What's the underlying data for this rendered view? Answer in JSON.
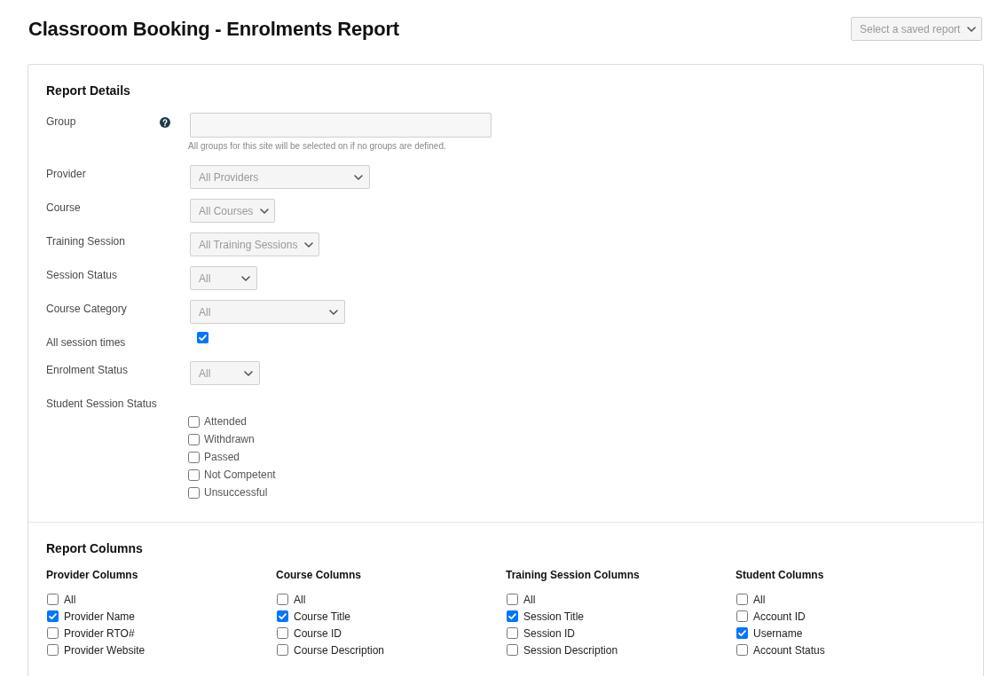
{
  "page": {
    "title": "Classroom Booking - Enrolments Report",
    "saved_report": {
      "value": "Select a saved report"
    }
  },
  "report_details": {
    "heading": "Report Details",
    "fields": [
      {
        "kind": "text",
        "label": "Group",
        "help": true,
        "hint": "All groups for this site will be selected on if no groups are defined."
      },
      {
        "kind": "select",
        "label": "Provider",
        "help": false,
        "value": "All Providers"
      },
      {
        "kind": "select",
        "label": "Course",
        "help": false,
        "value": "All Courses"
      },
      {
        "kind": "select",
        "label": "Training Session",
        "help": false,
        "value": "All Training Sessions"
      },
      {
        "kind": "select",
        "label": "Session Status",
        "help": false,
        "value": "All"
      },
      {
        "kind": "select",
        "label": "Course Category",
        "help": false,
        "value": "All"
      },
      {
        "kind": "checkbox",
        "label": "All session times",
        "help": false,
        "checked": true
      },
      {
        "kind": "select",
        "label": "Enrolment Status",
        "help": false,
        "value": "All"
      },
      {
        "kind": "checklist",
        "label": "Student Session Status",
        "help": false,
        "options": [
          {
            "label": "Attended",
            "checked": false
          },
          {
            "label": "Withdrawn",
            "checked": false
          },
          {
            "label": "Passed",
            "checked": false
          },
          {
            "label": "Not Competent",
            "checked": false
          },
          {
            "label": "Unsuccessful",
            "checked": false
          }
        ]
      }
    ]
  },
  "report_columns": {
    "heading": "Report Columns",
    "groups": [
      {
        "heading": "Provider Columns",
        "options": [
          {
            "label": "All",
            "checked": false
          },
          {
            "label": "Provider Name",
            "checked": true
          },
          {
            "label": "Provider RTO#",
            "checked": false
          },
          {
            "label": "Provider Website",
            "checked": false
          }
        ]
      },
      {
        "heading": "Course Columns",
        "options": [
          {
            "label": "All",
            "checked": false
          },
          {
            "label": "Course Title",
            "checked": true
          },
          {
            "label": "Course ID",
            "checked": false
          },
          {
            "label": "Course Description",
            "checked": false
          }
        ]
      },
      {
        "heading": "Training Session Columns",
        "options": [
          {
            "label": "All",
            "checked": false
          },
          {
            "label": "Session Title",
            "checked": true
          },
          {
            "label": "Session ID",
            "checked": false
          },
          {
            "label": "Session Description",
            "checked": false
          }
        ]
      },
      {
        "heading": "Student Columns",
        "options": [
          {
            "label": "All",
            "checked": false
          },
          {
            "label": "Account ID",
            "checked": false
          },
          {
            "label": "Username",
            "checked": true
          },
          {
            "label": "Account Status",
            "checked": false
          }
        ]
      }
    ]
  }
}
